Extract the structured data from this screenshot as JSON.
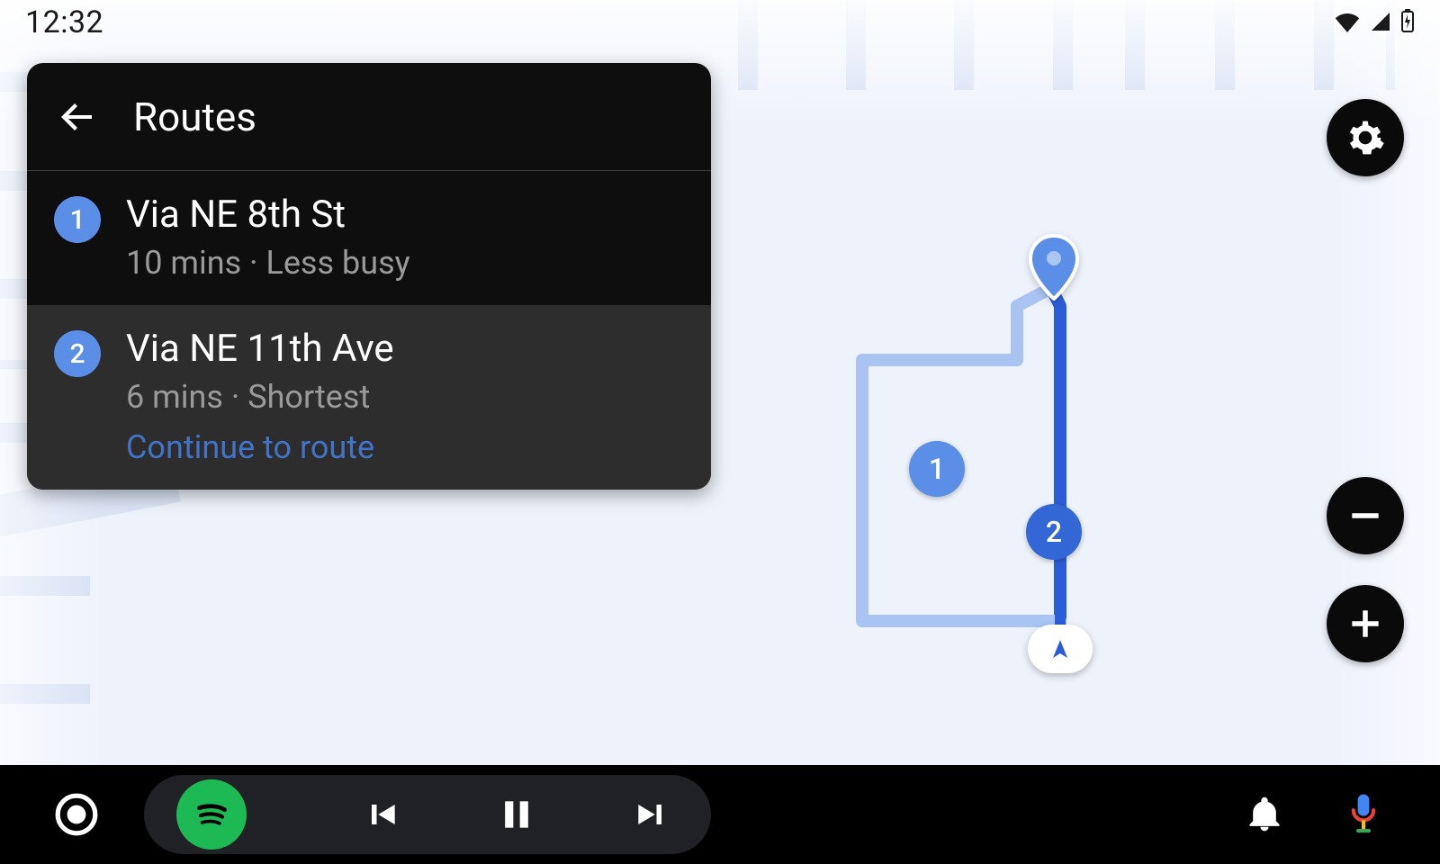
{
  "status": {
    "clock": "12:32"
  },
  "panel": {
    "title": "Routes",
    "routes": [
      {
        "badge": "1",
        "title": "Via NE 8th St",
        "subtitle": "10 mins · Less busy",
        "cta": ""
      },
      {
        "badge": "2",
        "title": "Via NE 11th Ave",
        "subtitle": "6 mins · Shortest",
        "cta": "Continue to route"
      }
    ]
  },
  "map": {
    "markers": {
      "route1": "1",
      "route2": "2"
    }
  },
  "colors": {
    "accent": "#3367d6",
    "accentLight": "#5b8ee6",
    "spotify": "#1DB954"
  }
}
